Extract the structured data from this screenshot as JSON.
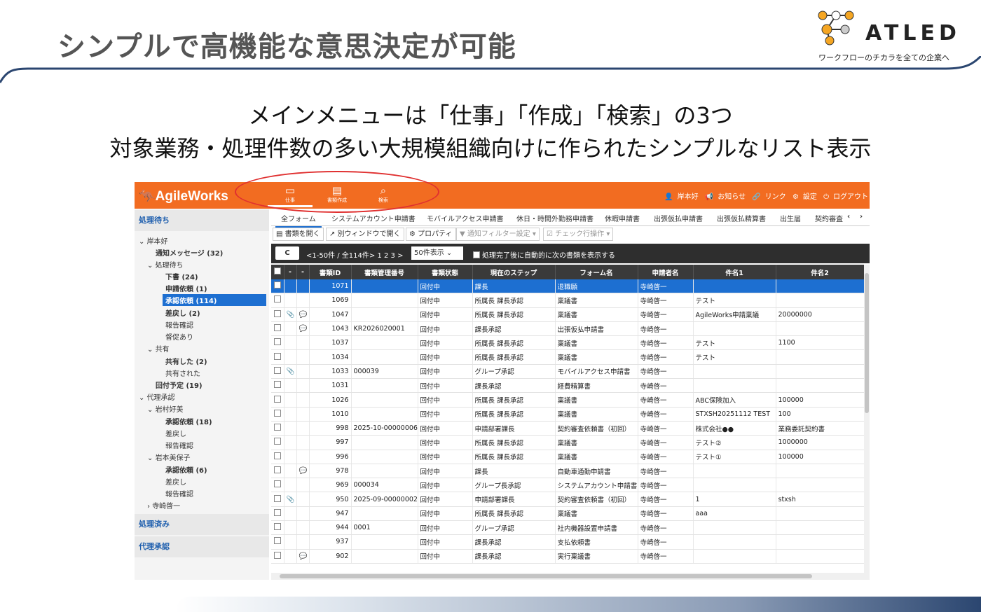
{
  "slide": {
    "title": "シンプルで高機能な意思決定が可能",
    "headline1": "メインメニューは「仕事」「作成」「検索」の3つ",
    "headline2": "対象業務・処理件数の多い大規模組織向けに作られたシンプルなリスト表示"
  },
  "logo": {
    "name": "ATLED",
    "tagline": "ワークフローのチカラを全ての企業へ"
  },
  "app": {
    "brand": "AgileWorks",
    "nav": [
      {
        "label": "仕事",
        "icon": "inbox-icon"
      },
      {
        "label": "書類作成",
        "icon": "document-icon"
      },
      {
        "label": "検索",
        "icon": "search-icon"
      }
    ],
    "toplinks": {
      "user": "岸本好",
      "notice": "お知らせ",
      "link": "リンク",
      "settings": "設定",
      "logout": "ログアウト"
    },
    "sidebar": {
      "section1": "処理待ち",
      "section2": "処理済み",
      "section3": "代理承認",
      "tree": [
        "岸本好",
        "通知メッセージ (32)",
        "処理待ち",
        "下書 (24)",
        "申請依頼 (1)",
        "承認依頼 (114)",
        "差戻し (2)",
        "報告確認",
        "督促あり",
        "共有",
        "共有した (2)",
        "共有された",
        "回付予定 (19)",
        "代理承認",
        "岩村好美",
        "承認依頼 (18)",
        "差戻し",
        "報告確認",
        "岩本美保子",
        "承認依頼 (6)",
        "差戻し",
        "報告確認",
        "寺崎啓一"
      ]
    },
    "formtabs": [
      "全フォーム",
      "システムアカウント申請書",
      "モバイルアクセス申請書",
      "休日・時間外勤務申請書",
      "休暇申請書",
      "出張仮払申請書",
      "出張仮払精算書",
      "出生届",
      "契約審査"
    ],
    "toolbar": {
      "open": "書類を開く",
      "newwin": "別ウィンドウで開く",
      "props": "プロパティ",
      "filter": "通知フィルター設定",
      "check": "チェック行操作"
    },
    "pager": {
      "refresh": "C",
      "range": "<1-50件 / 全114件>",
      "pages": "1  2  3  >",
      "perpage": "50件表示",
      "auto": "処理完了後に自動的に次の書類を表示する"
    },
    "columns": [
      "",
      "-",
      "-",
      "書類ID",
      "書類管理番号",
      "書類状態",
      "現在のステップ",
      "フォーム名",
      "申請者名",
      "件名1",
      "件名2"
    ],
    "rows": [
      {
        "clip": "",
        "msg": "",
        "id": "1071",
        "no": "",
        "state": "回付中",
        "step": "課長",
        "form": "退職願",
        "user": "寺崎啓一",
        "s1": "",
        "s2": ""
      },
      {
        "clip": "",
        "msg": "",
        "id": "1069",
        "no": "",
        "state": "回付中",
        "step": "所属長 課長承認",
        "form": "稟議書",
        "user": "寺崎啓一",
        "s1": "テスト",
        "s2": ""
      },
      {
        "clip": "clip",
        "msg": "msg",
        "id": "1047",
        "no": "",
        "state": "回付中",
        "step": "所属長 課長承認",
        "form": "稟議書",
        "user": "寺崎啓一",
        "s1": "AgileWorks申請稟議",
        "s2": "20000000"
      },
      {
        "clip": "",
        "msg": "msg",
        "id": "1043",
        "no": "KR2026020001",
        "state": "回付中",
        "step": "課長承認",
        "form": "出張仮払申請書",
        "user": "寺崎啓一",
        "s1": "",
        "s2": ""
      },
      {
        "clip": "",
        "msg": "",
        "id": "1037",
        "no": "",
        "state": "回付中",
        "step": "所属長 課長承認",
        "form": "稟議書",
        "user": "寺崎啓一",
        "s1": "テスト",
        "s2": "1100"
      },
      {
        "clip": "",
        "msg": "",
        "id": "1034",
        "no": "",
        "state": "回付中",
        "step": "所属長 課長承認",
        "form": "稟議書",
        "user": "寺崎啓一",
        "s1": "テスト",
        "s2": ""
      },
      {
        "clip": "clip",
        "msg": "",
        "id": "1033",
        "no": "000039",
        "state": "回付中",
        "step": "グループ承認",
        "form": "モバイルアクセス申請書",
        "user": "寺崎啓一",
        "s1": "",
        "s2": ""
      },
      {
        "clip": "",
        "msg": "",
        "id": "1031",
        "no": "",
        "state": "回付中",
        "step": "課長承認",
        "form": "経費精算書",
        "user": "寺崎啓一",
        "s1": "",
        "s2": ""
      },
      {
        "clip": "",
        "msg": "",
        "id": "1026",
        "no": "",
        "state": "回付中",
        "step": "所属長 課長承認",
        "form": "稟議書",
        "user": "寺崎啓一",
        "s1": "ABC保険加入",
        "s2": "100000"
      },
      {
        "clip": "",
        "msg": "",
        "id": "1010",
        "no": "",
        "state": "回付中",
        "step": "所属長 課長承認",
        "form": "稟議書",
        "user": "寺崎啓一",
        "s1": "STXSH20251112 TEST",
        "s2": "100"
      },
      {
        "clip": "",
        "msg": "",
        "id": "998",
        "no": "2025-10-00000006",
        "state": "回付中",
        "step": "申請部署課長",
        "form": "契約審査依頼書（初回）",
        "user": "寺崎啓一",
        "s1": "株式会社●●",
        "s2": "業務委託契約書"
      },
      {
        "clip": "",
        "msg": "",
        "id": "997",
        "no": "",
        "state": "回付中",
        "step": "所属長 課長承認",
        "form": "稟議書",
        "user": "寺崎啓一",
        "s1": "テスト②",
        "s2": "1000000"
      },
      {
        "clip": "",
        "msg": "",
        "id": "996",
        "no": "",
        "state": "回付中",
        "step": "所属長 課長承認",
        "form": "稟議書",
        "user": "寺崎啓一",
        "s1": "テスト①",
        "s2": "100000"
      },
      {
        "clip": "",
        "msg": "msg",
        "id": "978",
        "no": "",
        "state": "回付中",
        "step": "課長",
        "form": "自動車通勤申請書",
        "user": "寺崎啓一",
        "s1": "",
        "s2": ""
      },
      {
        "clip": "",
        "msg": "",
        "id": "969",
        "no": "000034",
        "state": "回付中",
        "step": "グループ長承認",
        "form": "システムアカウント申請書",
        "user": "寺崎啓一",
        "s1": "",
        "s2": ""
      },
      {
        "clip": "clip",
        "msg": "",
        "id": "950",
        "no": "2025-09-00000002",
        "state": "回付中",
        "step": "申請部署課長",
        "form": "契約審査依頼書（初回）",
        "user": "寺崎啓一",
        "s1": "1",
        "s2": "stxsh"
      },
      {
        "clip": "",
        "msg": "",
        "id": "947",
        "no": "",
        "state": "回付中",
        "step": "所属長 課長承認",
        "form": "稟議書",
        "user": "寺崎啓一",
        "s1": "aaa",
        "s2": ""
      },
      {
        "clip": "",
        "msg": "",
        "id": "944",
        "no": "0001",
        "state": "回付中",
        "step": "グループ承認",
        "form": "社内機器設置申請書",
        "user": "寺崎啓一",
        "s1": "",
        "s2": ""
      },
      {
        "clip": "",
        "msg": "",
        "id": "937",
        "no": "",
        "state": "回付中",
        "step": "課長承認",
        "form": "支払依頼書",
        "user": "寺崎啓一",
        "s1": "",
        "s2": ""
      },
      {
        "clip": "",
        "msg": "msg",
        "id": "902",
        "no": "",
        "state": "回付中",
        "step": "課長承認",
        "form": "実行稟議書",
        "user": "寺崎啓一",
        "s1": "",
        "s2": ""
      }
    ]
  },
  "colors": {
    "accent": "#f26c21",
    "selection": "#1d6fd1",
    "highlight_oval": "#e03030"
  }
}
